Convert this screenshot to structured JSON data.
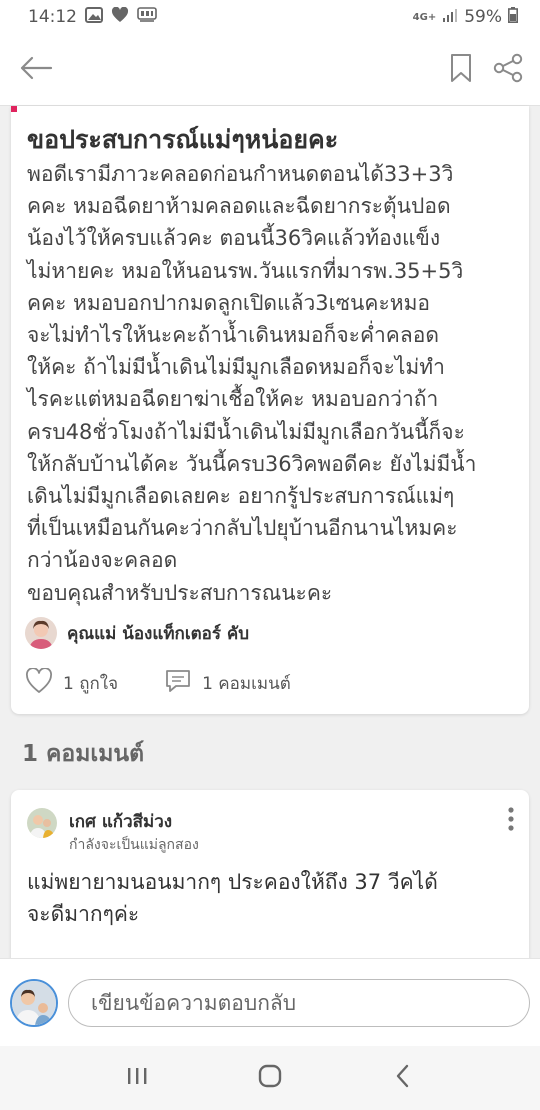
{
  "status_bar": {
    "time": "14:12",
    "network": "4G+",
    "battery": "59%"
  },
  "post": {
    "title": "ขอประสบการณ์แม่ๆหน่อยคะ",
    "body_lines": [
      "พอดีเรามีภาวะคลอดก่อนกำหนดตอนได้33+3วิ",
      "คคะ หมอฉีดยาห้ามคลอดและฉีดยากระตุ้นปอด",
      "น้องไว้ให้ครบแล้วคะ ตอนนี้36วิคแล้วท้องแข็ง",
      "ไม่หายคะ หมอให้นอนรพ.วันแรกที่มารพ.35+5วิ",
      "คคะ หมอบอกปากมดลูกเปิดแล้ว3เซนคะหมอ",
      "จะไม่ทำไรให้นะคะถ้าน้ำเดินหมอก็จะค่ำคลอด",
      "ให้คะ ถ้าไม่มีน้ำเดินไม่มีมูกเลือดหมอก็จะไม่ทำ",
      "ไรคะแต่หมอฉีดยาฆ่าเชื้อให้คะ หมอบอกว่าถ้า",
      "ครบ48ชั่วโมงถ้าไม่มีน้ำเดินไม่มีมูกเลือกวันนี้ก็จะ",
      "ให้กลับบ้านได้คะ วันนี้ครบ36วิคพอดีคะ ยังไม่มีน้ำ",
      "เดินไม่มีมูกเลือดเลยคะ อยากรู้ประสบการณ์แม่ๆ",
      "ที่เป็นเหมือนกันคะว่ากลับไปยุบ้านอีกนานไหมคะ",
      "กว่าน้องจะคลอด",
      "ขอบคุณสำหรับประสบการณนะคะ"
    ],
    "author": "คุณแม่ น้องแท็กเตอร์ คับ",
    "likes_label": "1 ถูกใจ",
    "comments_label": "1 คอมเมนต์"
  },
  "comments_heading": "1 คอมเมนต์",
  "comment": {
    "name": "เกศ แก้วสีม่วง",
    "subtitle": "กำลังจะเป็นแม่ลูกสอง",
    "text_lines": [
      "แม่พยายามนอนมากๆ ประคองให้ถึง 37 วีคได้",
      "จะดีมากๆค่ะ"
    ]
  },
  "reply": {
    "placeholder": "เขียนข้อความตอบกลับ"
  },
  "colors": {
    "accent": "#e0245e",
    "icon_gray": "#8a8a8a",
    "avatar_ring": "#4a90d9"
  },
  "icons": {
    "back": "arrow-left-icon",
    "bookmark": "bookmark-icon",
    "share": "share-icon",
    "like": "heart-icon",
    "comment": "comment-bubble-icon",
    "more": "more-vertical-icon"
  }
}
